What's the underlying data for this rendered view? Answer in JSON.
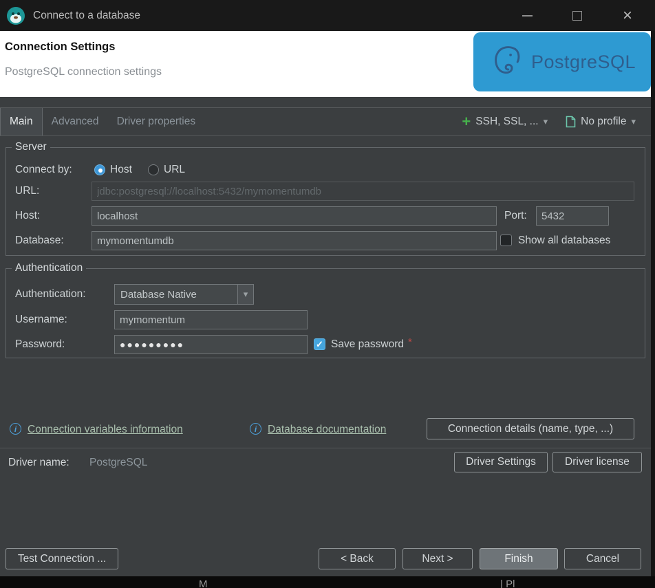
{
  "window": {
    "title": "Connect to a database"
  },
  "header": {
    "title": "Connection Settings",
    "subtitle": "PostgreSQL connection settings",
    "brand": "PostgreSQL"
  },
  "tabs": {
    "main": "Main",
    "advanced": "Advanced",
    "driver_properties": "Driver properties"
  },
  "toolbar": {
    "ssh": "SSH, SSL, ...",
    "profile": "No profile"
  },
  "server": {
    "group_title": "Server",
    "connect_by_label": "Connect by:",
    "host_radio_label": "Host",
    "url_radio_label": "URL",
    "url_label": "URL:",
    "url_value": "jdbc:postgresql://localhost:5432/mymomentumdb",
    "host_label": "Host:",
    "host_value": "localhost",
    "port_label": "Port:",
    "port_value": "5432",
    "database_label": "Database:",
    "database_value": "mymomentumdb",
    "show_all_label": "Show all databases"
  },
  "auth": {
    "group_title": "Authentication",
    "label": "Authentication:",
    "value": "Database Native",
    "username_label": "Username:",
    "username_value": "mymomentum",
    "password_label": "Password:",
    "password_value": "●●●●●●●●●",
    "save_password_label": "Save password",
    "required_marker": "*"
  },
  "links": {
    "variables": "Connection variables information",
    "documentation": "Database documentation",
    "details_button": "Connection details (name, type, ...)"
  },
  "driver": {
    "label": "Driver name:",
    "value": "PostgreSQL",
    "settings_button": "Driver Settings",
    "license_button": "Driver license"
  },
  "footer": {
    "test": "Test Connection ...",
    "back": "< Back",
    "next": "Next >",
    "finish": "Finish",
    "cancel": "Cancel"
  },
  "icons": {
    "plus": "+",
    "caret_down": "▾",
    "close": "×",
    "check": "✓",
    "info": "i"
  },
  "fragments": {
    "left": "M",
    "right": "| Pl"
  },
  "colors": {
    "banner_blue": "#2e9ad2",
    "brand_blue": "#2f5e8d",
    "accent_blue": "#3d96d6",
    "checkbox_blue": "#45a4dc",
    "link_green": "#a9bfad",
    "plus_green": "#46b14c",
    "error_red": "#c14b47",
    "panel_bg": "#3b3e40",
    "header_bg": "#ffffff",
    "titlebar_bg": "#191919"
  }
}
